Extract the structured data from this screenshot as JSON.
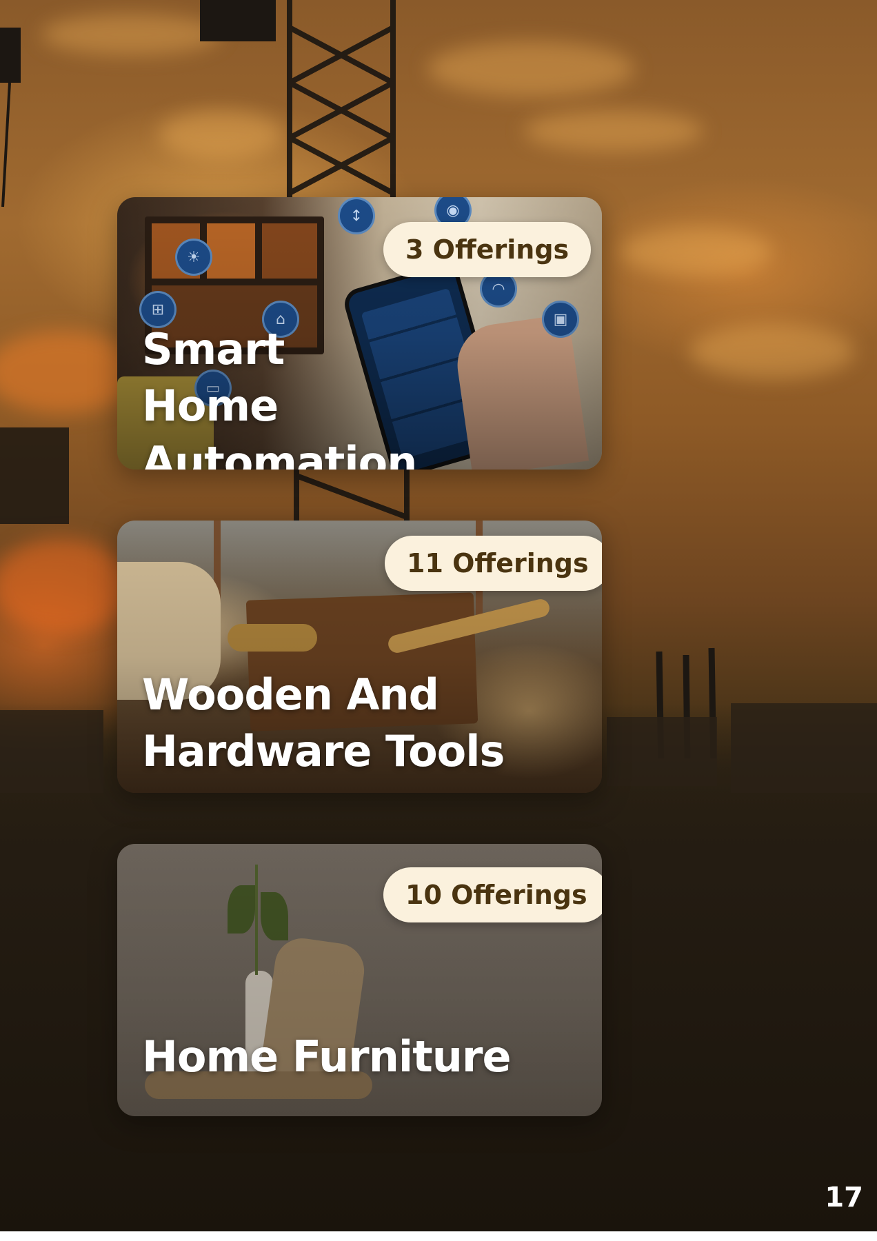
{
  "cards": [
    {
      "badge": "3 Offerings",
      "title": "Smart Home Automation"
    },
    {
      "badge": "11 Offerings",
      "title_line1": "Wooden And",
      "title_line2": "Hardware Tools"
    },
    {
      "badge": "10 Offerings",
      "title": "Home Furniture"
    }
  ],
  "page_number": "17",
  "colors": {
    "badge_bg": "#fbf1dd",
    "badge_text": "#4a3410",
    "title_text": "#ffffff",
    "smart_icon_bg": "#1e4f8f"
  },
  "icons": [
    "lightbulb-icon",
    "thermometer-icon",
    "camera-icon",
    "window-icon",
    "garage-icon",
    "wifi-icon",
    "lock-icon",
    "car-icon"
  ]
}
